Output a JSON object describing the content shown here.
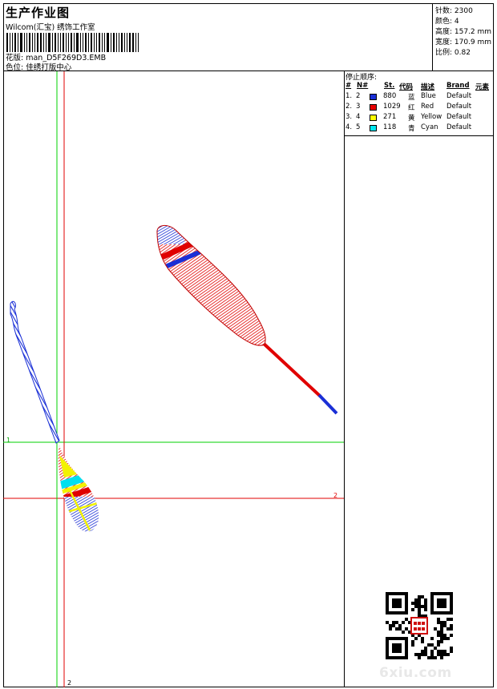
{
  "header": {
    "title": "生产作业图",
    "studio": "Wilcom(汇宝) 绣饰工作室",
    "design_line": "花版: man_D5F269D3.EMB",
    "color_line": "色位: 佳绣打版中心"
  },
  "stats": {
    "stitches": "针数: 2300",
    "colors": "颜色: 4",
    "height": "高度: 157.2 mm",
    "width": "宽度: 170.9 mm",
    "scale": "比例: 0.82"
  },
  "stop_sequence": {
    "title": "停止顺序:",
    "columns": [
      "#",
      "N#",
      "St.",
      "代码",
      "描述",
      "Brand",
      "元素"
    ],
    "rows": [
      {
        "idx": "1.",
        "n": "2",
        "color": "#1a2fd6",
        "st": "880",
        "code": "蓝",
        "desc": "Blue",
        "brand": "Default"
      },
      {
        "idx": "2.",
        "n": "3",
        "color": "#e80000",
        "st": "1029",
        "code": "红",
        "desc": "Red",
        "brand": "Default"
      },
      {
        "idx": "3.",
        "n": "4",
        "color": "#ffff00",
        "st": "271",
        "code": "黄",
        "desc": "Yellow",
        "brand": "Default"
      },
      {
        "idx": "4.",
        "n": "5",
        "color": "#00e8f0",
        "st": "118",
        "code": "青",
        "desc": "Cyan",
        "brand": "Default"
      }
    ]
  },
  "guides": {
    "h1_label": "1",
    "h2_label": "2",
    "v2_label": "2"
  },
  "watermark": "6xiu.com"
}
